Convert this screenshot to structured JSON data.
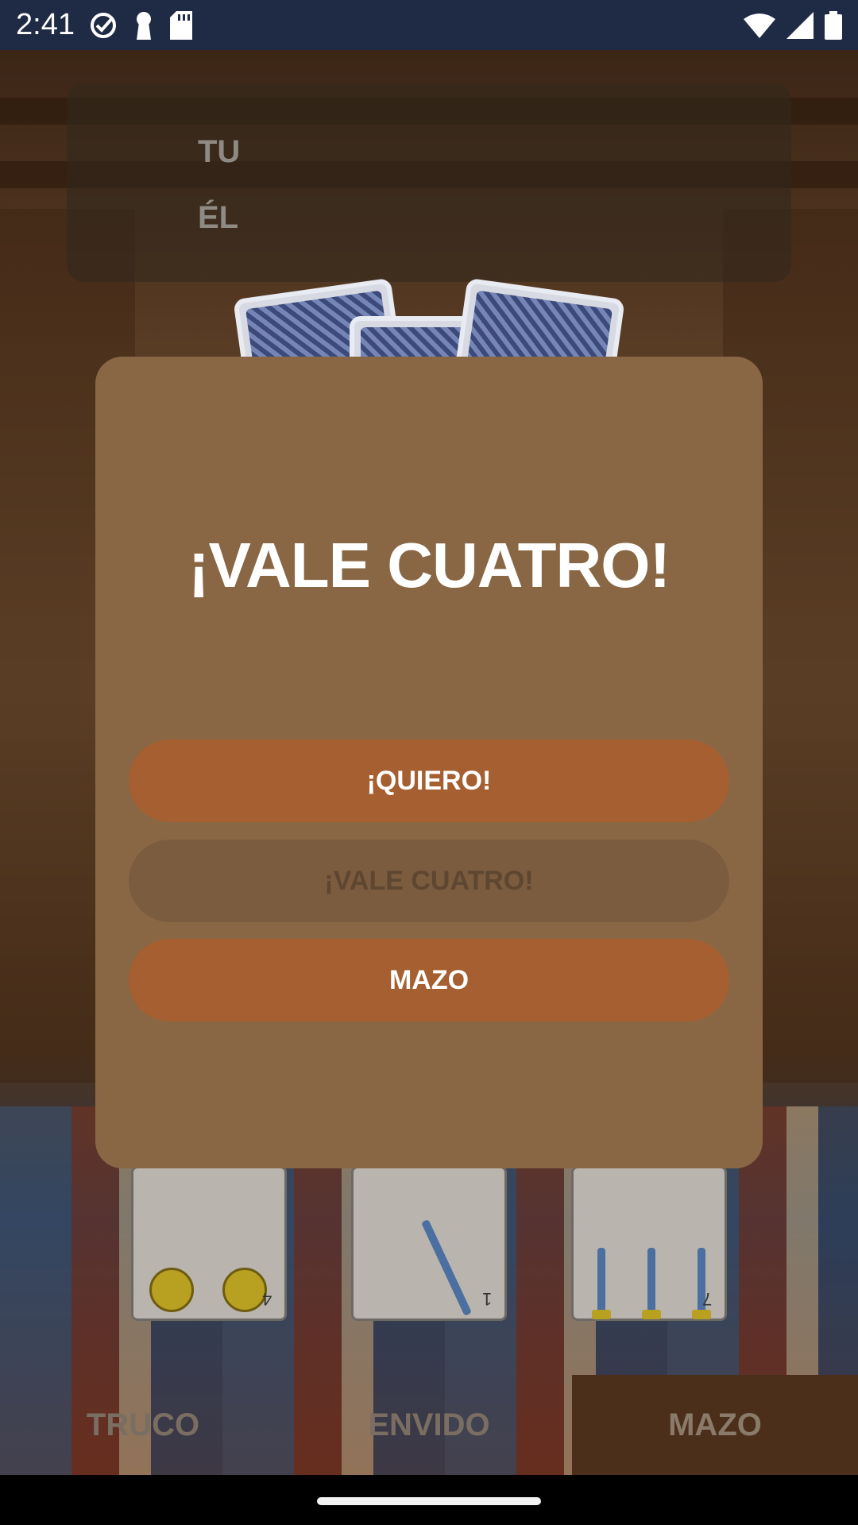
{
  "status_bar": {
    "time": "2:41",
    "left_icons": [
      "check-circle-icon",
      "keyhole-icon",
      "sd-card-icon"
    ],
    "right_icons": [
      "wifi-icon",
      "signal-icon",
      "battery-icon"
    ]
  },
  "scoreboard": {
    "player_label": "TU",
    "opponent_label": "ÉL"
  },
  "hand": {
    "cards": [
      {
        "suit": "oros",
        "number": "4"
      },
      {
        "suit": "espadas",
        "number": "1"
      },
      {
        "suit": "espadas",
        "number": "7"
      }
    ]
  },
  "action_bar": {
    "truco_label": "TRUCO",
    "envido_label": "ENVIDO",
    "mazo_label": "MAZO"
  },
  "dialog": {
    "title": "¡VALE CUATRO!",
    "quiero_label": "¡QUIERO!",
    "vale_cuatro_label": "¡VALE CUATRO!",
    "mazo_label": "MAZO"
  },
  "colors": {
    "dialog_bg": "#8a6744",
    "button_primary": "#a55f31",
    "button_disabled": "#7b5c3f",
    "status_bar": "#1f2a44"
  }
}
